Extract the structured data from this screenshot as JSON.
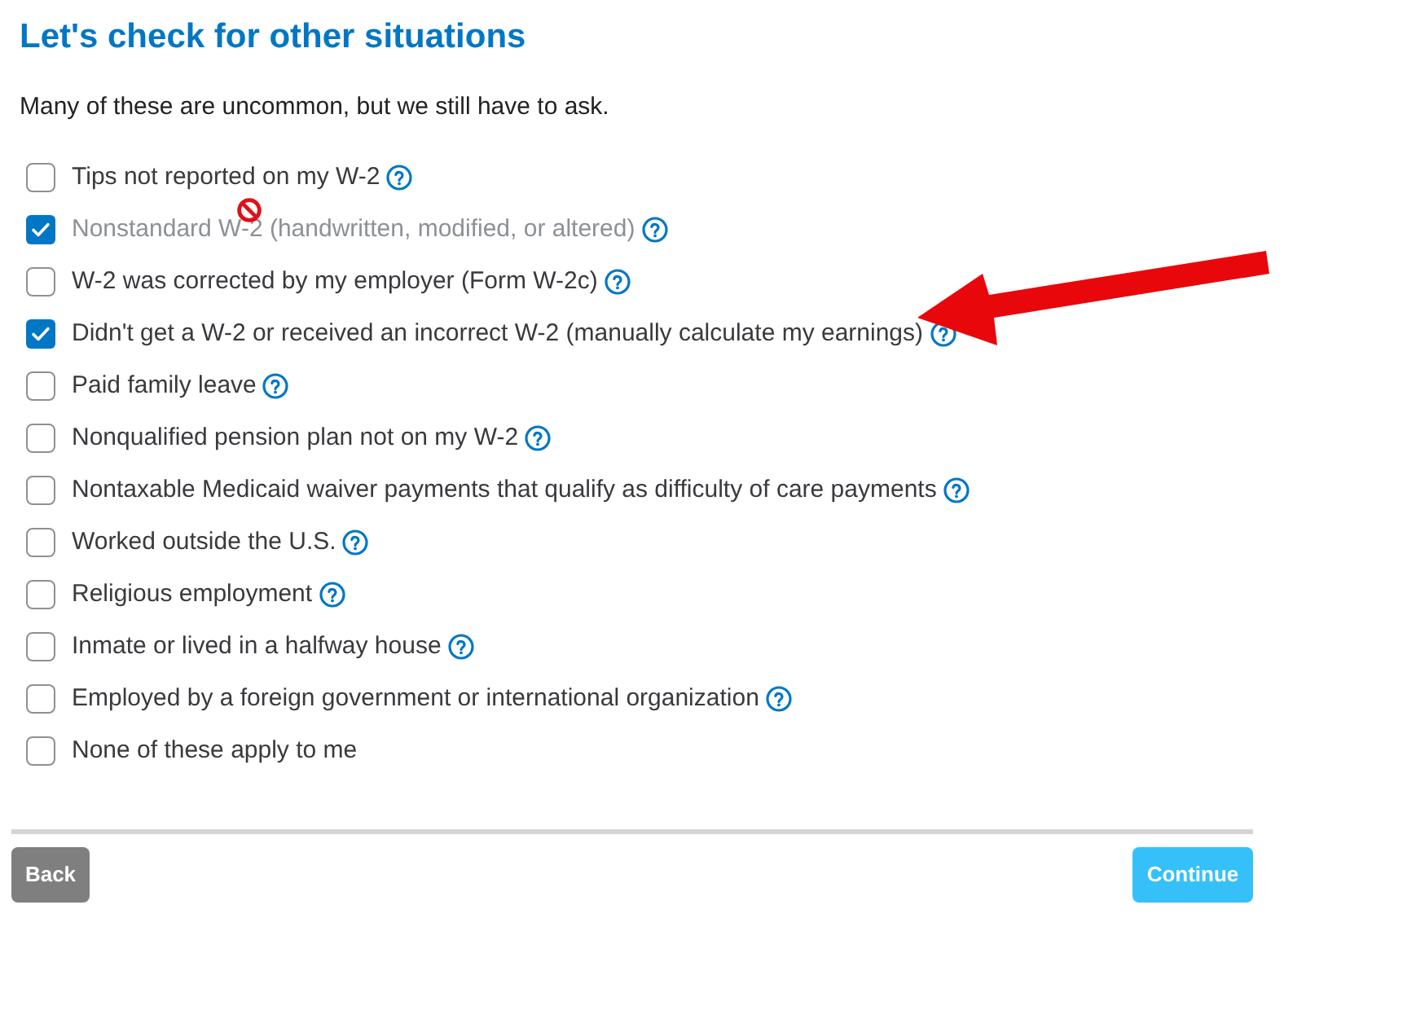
{
  "page": {
    "title": "Let's check for other situations",
    "subtitle": "Many of these are uncommon, but we still have to ask."
  },
  "options": [
    {
      "label": "Tips not reported on my W-2",
      "checked": false,
      "disabled": false,
      "help_icon": true
    },
    {
      "label": "Nonstandard W-2 (handwritten, modified, or altered)",
      "checked": true,
      "disabled": true,
      "help_icon": true
    },
    {
      "label": "W-2 was corrected by my employer (Form W-2c)",
      "checked": false,
      "disabled": false,
      "help_icon": true
    },
    {
      "label": "Didn't get a W-2 or received an incorrect W-2 (manually calculate my earnings)",
      "checked": true,
      "disabled": false,
      "help_icon": true
    },
    {
      "label": "Paid family leave",
      "checked": false,
      "disabled": false,
      "help_icon": true
    },
    {
      "label": "Nonqualified pension plan not on my W-2",
      "checked": false,
      "disabled": false,
      "help_icon": true
    },
    {
      "label": "Nontaxable Medicaid waiver payments that qualify as difficulty of care payments",
      "checked": false,
      "disabled": false,
      "help_icon": true
    },
    {
      "label": "Worked outside the U.S.",
      "checked": false,
      "disabled": false,
      "help_icon": true
    },
    {
      "label": "Religious employment",
      "checked": false,
      "disabled": false,
      "help_icon": true
    },
    {
      "label": "Inmate or lived in a halfway house",
      "checked": false,
      "disabled": false,
      "help_icon": true
    },
    {
      "label": "Employed by a foreign government or international organization",
      "checked": false,
      "disabled": false,
      "help_icon": true
    },
    {
      "label": "None of these apply to me",
      "checked": false,
      "disabled": false,
      "help_icon": false
    }
  ],
  "buttons": [
    {
      "label": "Back",
      "kind": "secondary"
    },
    {
      "label": "Continue",
      "kind": "primary"
    }
  ]
}
